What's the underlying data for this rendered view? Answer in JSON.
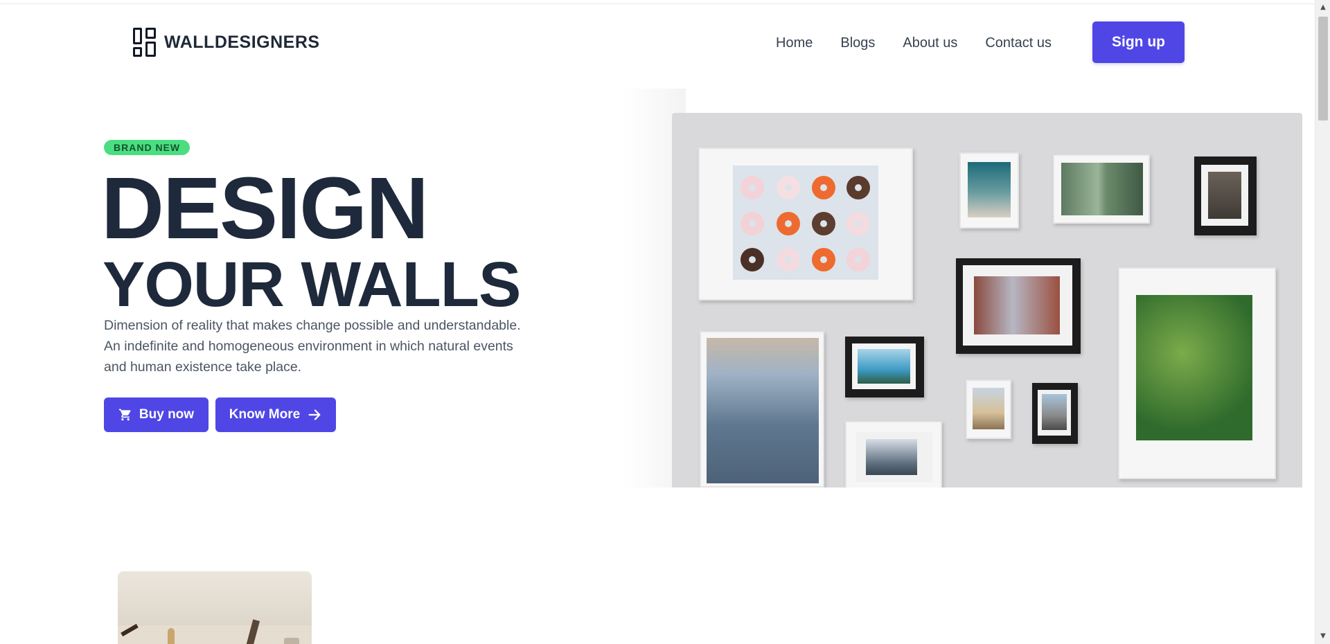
{
  "brand": {
    "name": "WALLDESIGNERS",
    "logo_icon": "layout-grid-icon"
  },
  "nav": {
    "items": [
      {
        "label": "Home"
      },
      {
        "label": "Blogs"
      },
      {
        "label": "About us"
      },
      {
        "label": "Contact us"
      }
    ],
    "signup_label": "Sign up"
  },
  "hero": {
    "badge": "BRAND NEW",
    "headline_line1": "DESIGN",
    "headline_line2": "YOUR WALLS",
    "description": "Dimension of reality that makes change possible and understandable. An indefinite and homogeneous environment in which natural events and human existence take place.",
    "buy_button": {
      "label": "Buy now",
      "icon": "cart-icon"
    },
    "more_button": {
      "label": "Know More",
      "icon": "arrow-right-icon"
    }
  },
  "colors": {
    "accent": "#4f46e5",
    "badge_bg": "#4ade80",
    "heading": "#1e293b",
    "body_text": "#4b5563"
  }
}
